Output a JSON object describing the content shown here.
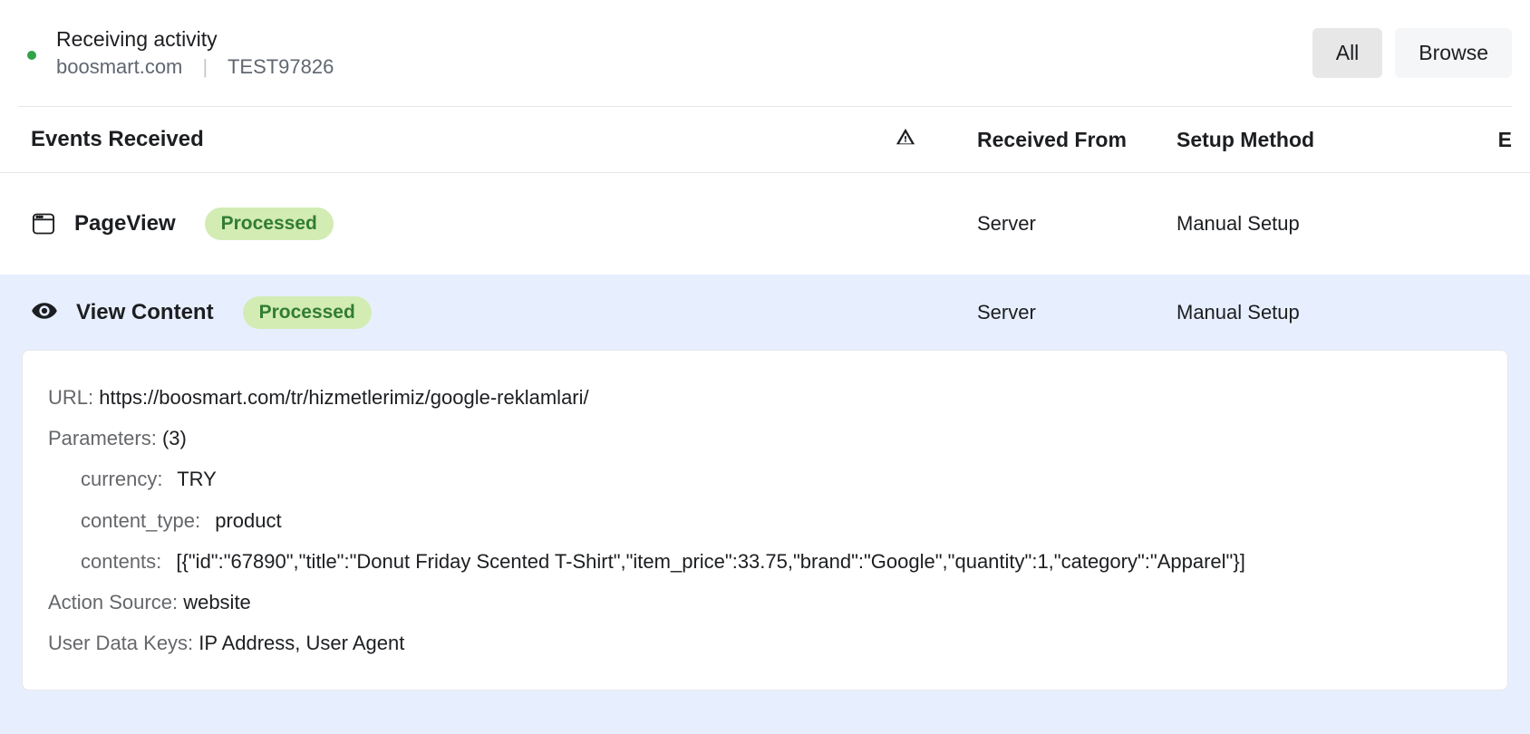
{
  "header": {
    "status_title": "Receiving activity",
    "domain": "boosmart.com",
    "pixel_id": "TEST97826"
  },
  "tabs": {
    "all": "All",
    "browse": "Browse"
  },
  "columns": {
    "events": "Events Received",
    "from": "Received From",
    "setup": "Setup Method",
    "e": "E"
  },
  "events": [
    {
      "name": "PageView",
      "status": "Processed",
      "from": "Server",
      "setup": "Manual Setup"
    },
    {
      "name": "View Content",
      "status": "Processed",
      "from": "Server",
      "setup": "Manual Setup"
    }
  ],
  "details": {
    "url_label": "URL:",
    "url_value": "https://boosmart.com/tr/hizmetlerimiz/google-reklamlari/",
    "params_label": "Parameters:",
    "params_count": "(3)",
    "currency_label": "currency:",
    "currency_value": "TRY",
    "content_type_label": "content_type:",
    "content_type_value": "product",
    "contents_label": "contents:",
    "contents_value": "[{\"id\":\"67890\",\"title\":\"Donut Friday Scented T-Shirt\",\"item_price\":33.75,\"brand\":\"Google\",\"quantity\":1,\"category\":\"Apparel\"}]",
    "action_source_label": "Action Source:",
    "action_source_value": "website",
    "user_data_label": "User Data Keys:",
    "user_data_value": "IP Address, User Agent"
  }
}
